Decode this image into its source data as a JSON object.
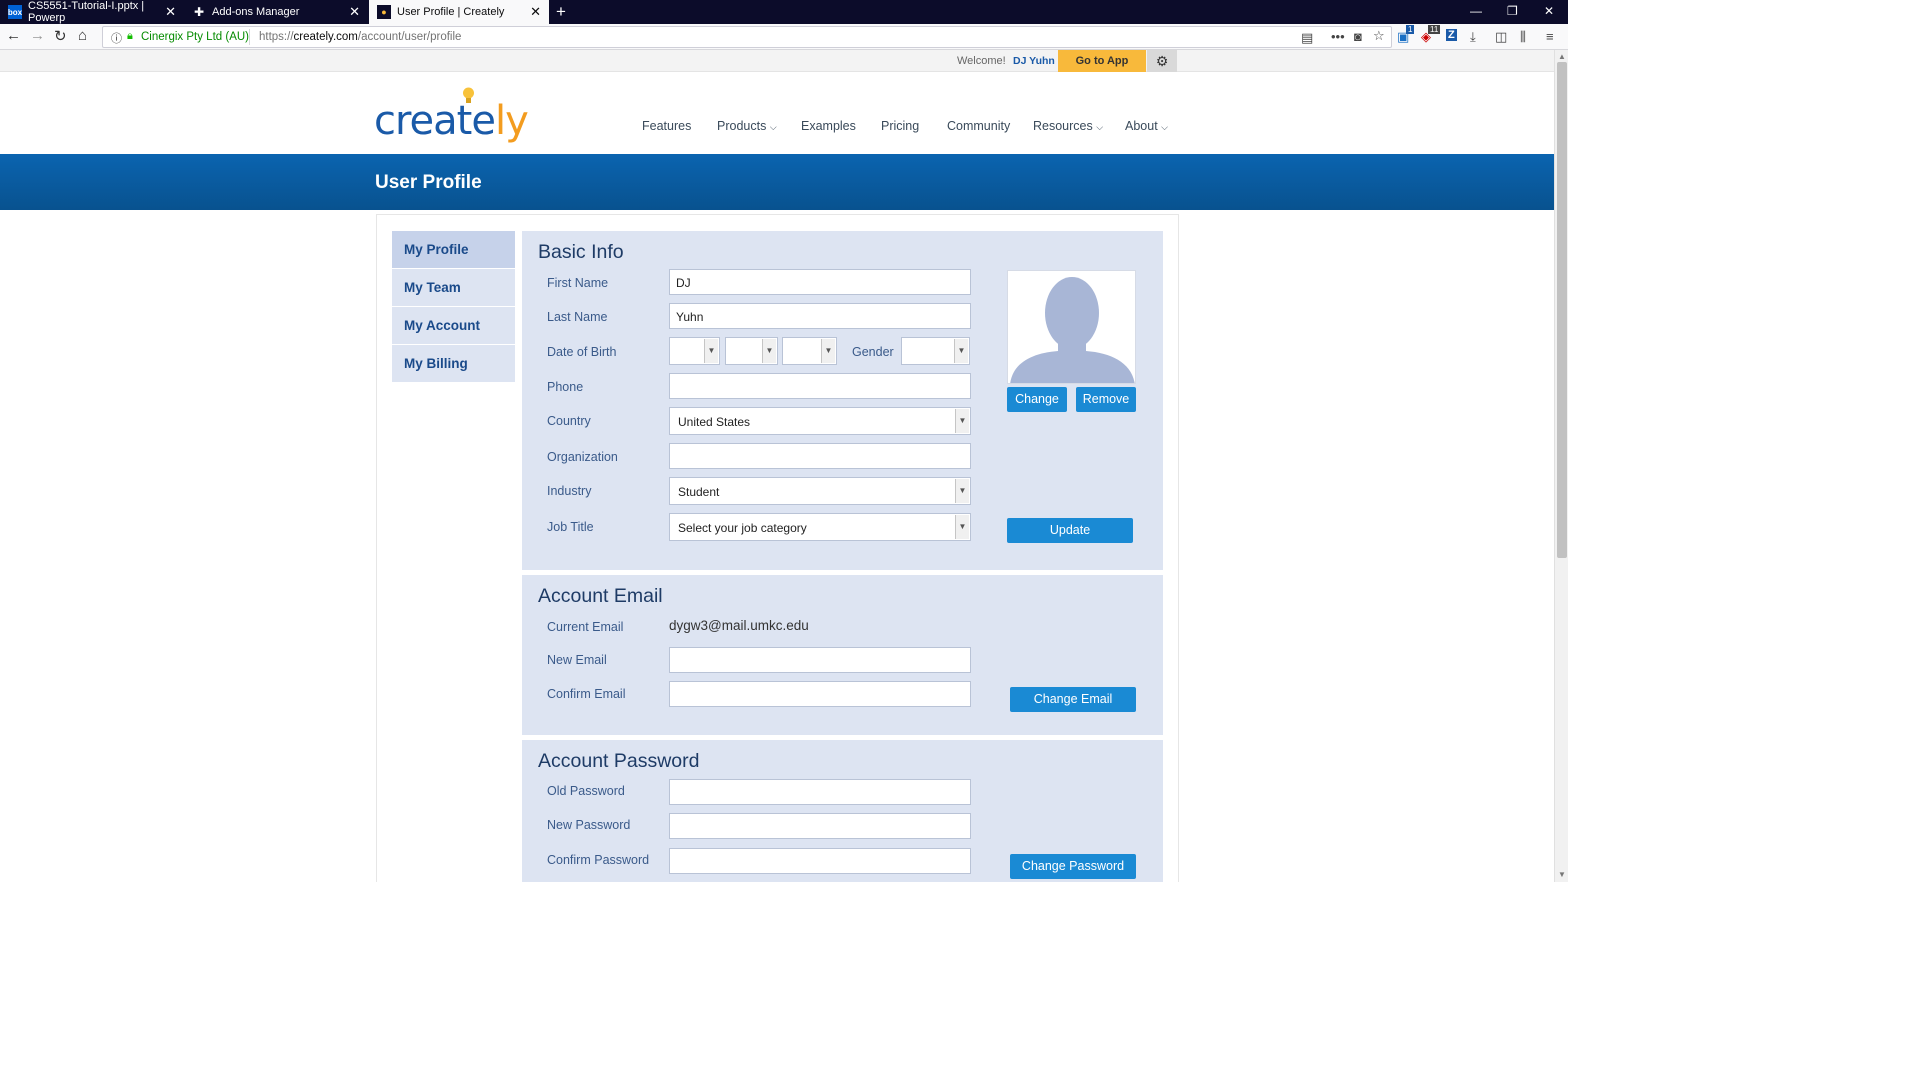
{
  "browser": {
    "tabs": [
      {
        "label": "CS5551-Tutorial-I.pptx | Powerp",
        "icon": "box-icon"
      },
      {
        "label": "Add-ons Manager",
        "icon": "puzzle-icon"
      },
      {
        "label": "User Profile | Creately",
        "icon": "creately-icon"
      }
    ],
    "org": "Cinergix Pty Ltd (AU)",
    "url_prefix": "https://",
    "url_domain": "creately.com",
    "url_path": "/account/user/profile",
    "badge1": "1",
    "badge2": "11"
  },
  "topbar": {
    "welcome": "Welcome!",
    "username": "DJ Yuhn",
    "go_to_app": "Go to App"
  },
  "logo": {
    "part1": "create",
    "part2": "ly"
  },
  "nav": {
    "features": "Features",
    "products": "Products",
    "examples": "Examples",
    "pricing": "Pricing",
    "community": "Community",
    "resources": "Resources",
    "about": "About"
  },
  "banner_title": "User Profile",
  "sidebar": {
    "items": [
      "My Profile",
      "My Team",
      "My Account",
      "My Billing"
    ]
  },
  "basic_info": {
    "title": "Basic Info",
    "first_name_label": "First Name",
    "first_name": "DJ",
    "last_name_label": "Last Name",
    "last_name": "Yuhn",
    "dob_label": "Date of Birth",
    "gender_label": "Gender",
    "phone_label": "Phone",
    "country_label": "Country",
    "country": "United States",
    "organization_label": "Organization",
    "industry_label": "Industry",
    "industry": "Student",
    "job_title_label": "Job Title",
    "job_title": "Select your job category",
    "change_btn": "Change",
    "remove_btn": "Remove",
    "update_btn": "Update"
  },
  "account_email": {
    "title": "Account Email",
    "current_label": "Current Email",
    "current": "dygw3@mail.umkc.edu",
    "new_label": "New Email",
    "confirm_label": "Confirm Email",
    "change_btn": "Change Email"
  },
  "account_password": {
    "title": "Account Password",
    "old_label": "Old Password",
    "new_label": "New Password",
    "confirm_label": "Confirm Password",
    "change_btn": "Change Password"
  },
  "colors": {
    "brand_blue": "#1a5aa8",
    "brand_orange": "#f39c1f",
    "banner": "#0a5aa0",
    "panel": "#dde4f2",
    "button": "#1a8ad4",
    "go_to_app": "#f8b93b"
  }
}
